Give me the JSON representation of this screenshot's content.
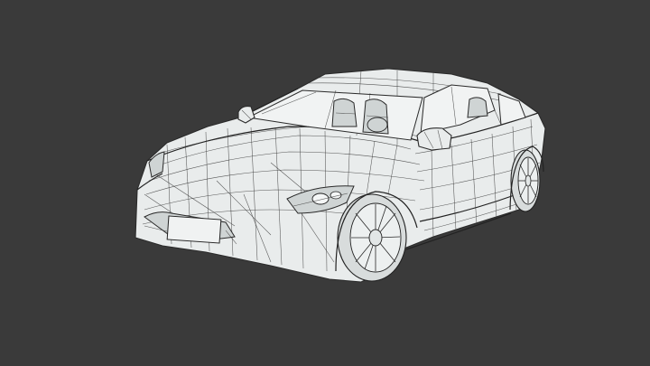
{
  "scene": {
    "subject": "car-wireframe-model",
    "colors": {
      "background": "#3a3a3a",
      "surface": "#e9ecec",
      "wire": "#3c3c3c"
    }
  }
}
